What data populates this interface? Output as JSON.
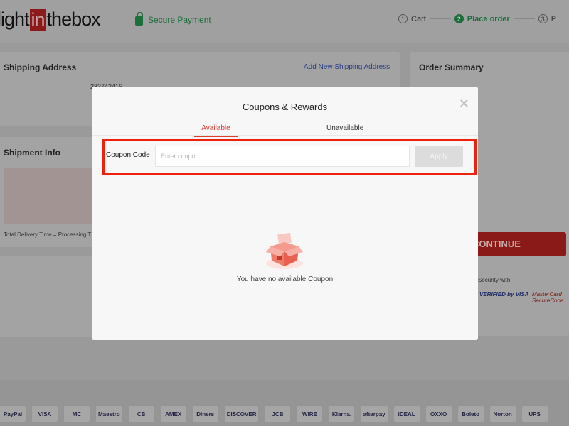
{
  "header": {
    "logo_parts": [
      "light",
      "in",
      "thebox"
    ],
    "secure_label": "Secure Payment",
    "steps": [
      {
        "num": "1",
        "label": "Cart"
      },
      {
        "num": "2",
        "label": "Place order"
      },
      {
        "num": "3",
        "label": "P"
      }
    ]
  },
  "shipping": {
    "title": "Shipping Address",
    "add_link": "Add New Shipping Address",
    "phone": "283742416"
  },
  "shipment": {
    "title": "Shipment Info",
    "delivery_note": "Total Delivery Time = Processing T"
  },
  "summary": {
    "title": "Order Summary",
    "continue_label": "CONTINUE",
    "security_label": "Security with",
    "badges": [
      "VERIFIED by VISA",
      "MasterCard SecureCode"
    ]
  },
  "payment_logos": [
    "PayPal",
    "VISA",
    "MC",
    "Maestro",
    "CB",
    "AMEX",
    "Diners",
    "DISCOVER",
    "JCB",
    "WIRE",
    "Klarna.",
    "afterpay",
    "iDEAL",
    "OXXO",
    "Boleto",
    "Norton",
    "UPS"
  ],
  "modal": {
    "title": "Coupons & Rewards",
    "tabs": [
      "Available",
      "Unavailable"
    ],
    "coupon_label": "Coupon Code",
    "coupon_placeholder": "Enter coupon",
    "coupon_value": "",
    "apply_label": "Apply",
    "empty_text": "You have no available Coupon",
    "accent": "#e23a2f",
    "highlight": "#f0210c"
  }
}
